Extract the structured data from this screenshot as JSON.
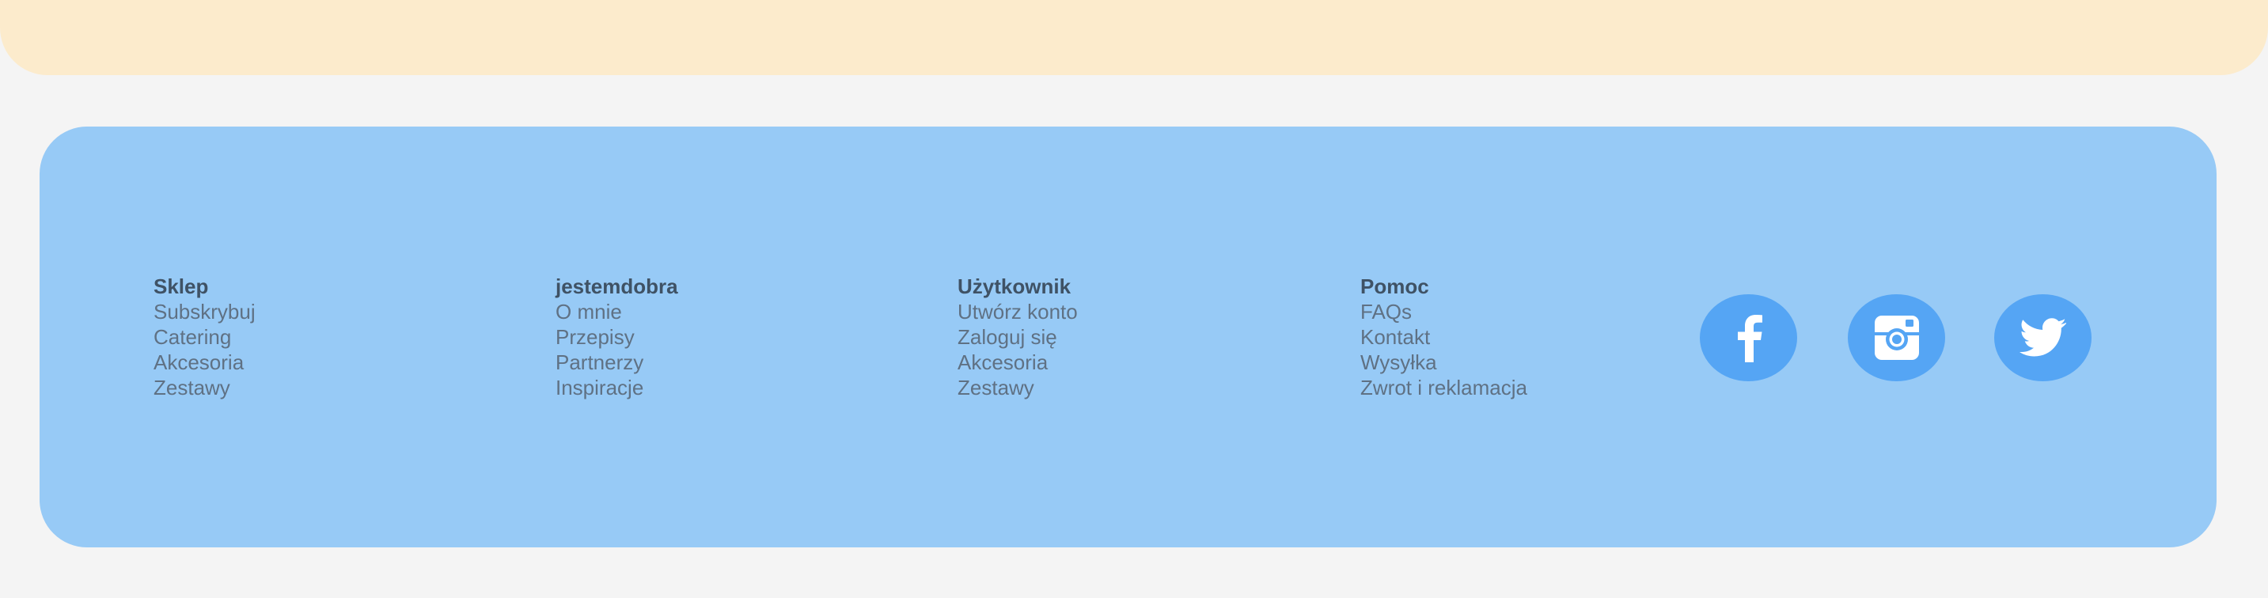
{
  "footer": {
    "columns": [
      {
        "heading": "Sklep",
        "links": [
          "Subskrybuj",
          "Catering",
          "Akcesoria",
          "Zestawy"
        ]
      },
      {
        "heading": "jestemdobra",
        "links": [
          "O mnie",
          "Przepisy",
          "Partnerzy",
          "Inspiracje"
        ]
      },
      {
        "heading": "Użytkownik",
        "links": [
          "Utwórz konto",
          "Zaloguj się",
          "Akcesoria",
          "Zestawy"
        ]
      },
      {
        "heading": "Pomoc",
        "links": [
          "FAQs",
          "Kontakt",
          "Wysyłka",
          "Zwrot i reklamacja"
        ]
      }
    ],
    "social": [
      {
        "icon": "facebook-icon"
      },
      {
        "icon": "instagram-icon"
      },
      {
        "icon": "twitter-icon"
      }
    ]
  },
  "colors": {
    "top_band": "#fcebcc",
    "page_background": "#f4f4f4",
    "footer_background": "#97caf6",
    "social_circle": "#55a5f4",
    "text": "#5f7184",
    "heading": "#3f5265"
  }
}
